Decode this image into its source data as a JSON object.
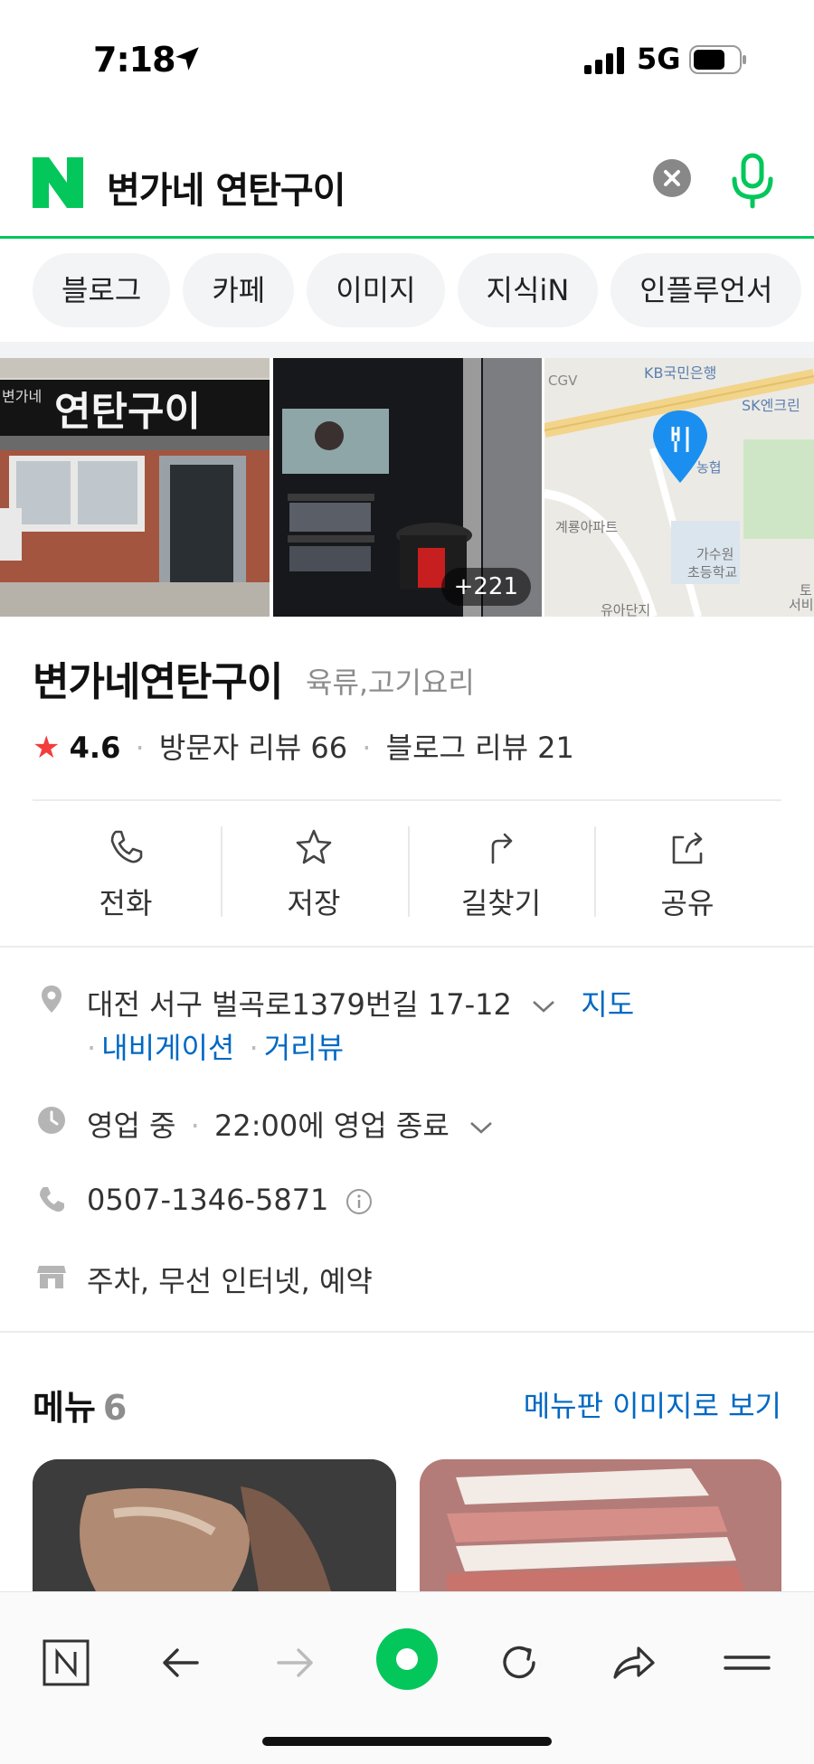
{
  "status_bar": {
    "time": "7:18",
    "network": "5G"
  },
  "search": {
    "query": "변가네 연탄구이"
  },
  "chips": [
    "블로그",
    "카페",
    "이미지",
    "지식iN",
    "인플루언서"
  ],
  "photos": {
    "more_count": "+221"
  },
  "map_labels": {
    "bank": "KB국민은행",
    "cgv": "CGV",
    "sk": "SK엔크린",
    "nonghyup": "농협",
    "apt": "계룡아파트",
    "school1": "가수원",
    "school2": "초등학교",
    "edge1": "토",
    "edge2": "서비",
    "complex": "유아단지"
  },
  "sign_text": "연탄구이",
  "sign_small": "변가네",
  "place": {
    "name": "변가네연탄구이",
    "category": "육류,고기요리",
    "rating": "4.6",
    "visitor_reviews": "방문자 리뷰 66",
    "blog_reviews": "블로그 리뷰 21"
  },
  "actions": [
    "전화",
    "저장",
    "길찾기",
    "공유"
  ],
  "address": {
    "text": "대전 서구 벌곡로1379번길 17-12",
    "map_link": "지도",
    "navi_link": "내비게이션",
    "street_link": "거리뷰"
  },
  "hours": {
    "status": "영업 중",
    "detail": "22:00에 영업 종료"
  },
  "phone": "0507-1346-5871",
  "amenities": "주차, 무선 인터넷, 예약",
  "menu": {
    "title": "메뉴",
    "count": "6",
    "image_link": "메뉴판 이미지로 보기"
  },
  "colors": {
    "naver_green": "#03c75a",
    "link_blue": "#0068c3",
    "star_red": "#f33c3c"
  },
  "icons": [
    "location-arrow-icon",
    "signal-icon",
    "battery-icon",
    "naver-logo-icon",
    "clear-icon",
    "mic-icon",
    "phone-icon",
    "star-icon",
    "directions-icon",
    "share-icon",
    "pin-icon",
    "clock-icon",
    "store-icon",
    "info-icon",
    "naver-home-icon",
    "back-icon",
    "forward-icon",
    "green-dot-icon",
    "refresh-icon",
    "share-arrow-icon",
    "menu-icon"
  ]
}
